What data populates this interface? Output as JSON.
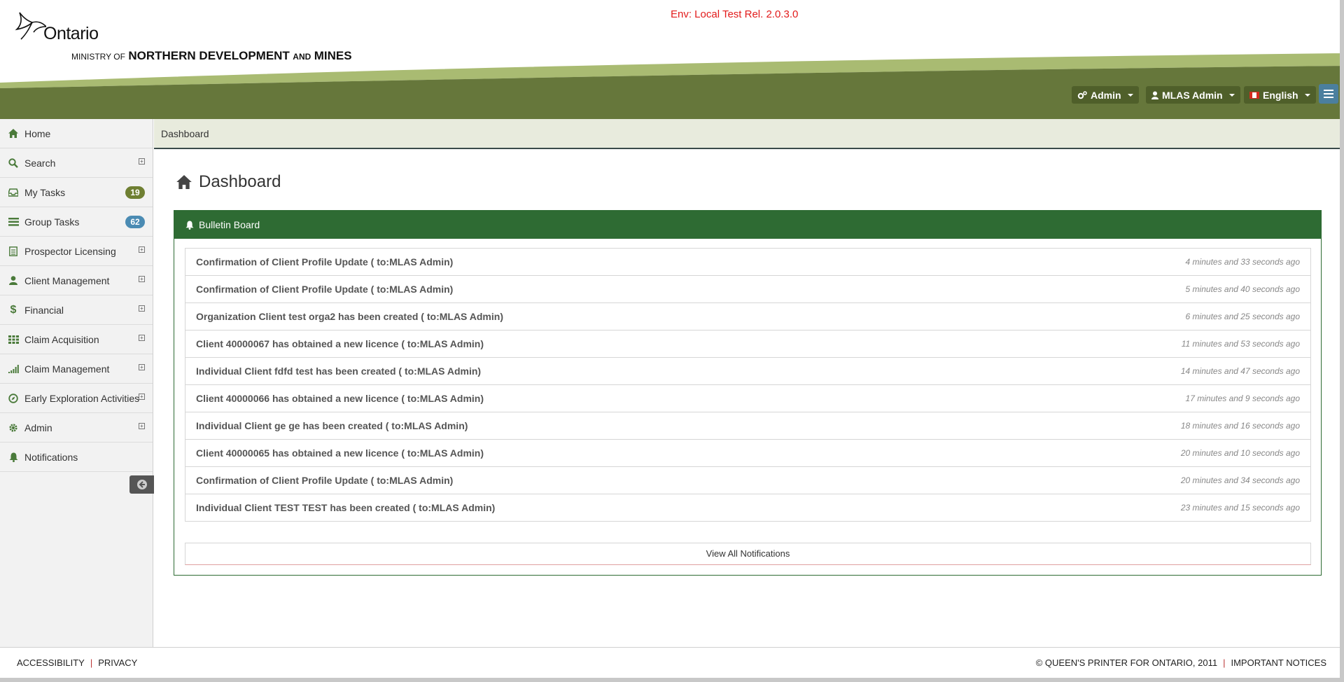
{
  "header": {
    "logo_text": "Ontario",
    "ministry_prefix": "MINISTRY OF",
    "ministry_part1": "NORTHERN DEVELOPMENT",
    "ministry_and": "AND",
    "ministry_part2": "MINES",
    "env_label": "Env: Local Test Rel. 2.0.3.0",
    "admin_menu": "Admin",
    "user_menu": "MLAS Admin",
    "language_menu": "English",
    "colors": {
      "band_dark": "#66773b",
      "band_light": "#a9bb72",
      "env_text": "#e21b1b"
    }
  },
  "sidebar": {
    "items": [
      {
        "label": "Home",
        "icon": "home-icon"
      },
      {
        "label": "Search",
        "icon": "search-icon",
        "expandable": true
      },
      {
        "label": "My Tasks",
        "icon": "inbox-icon",
        "badge": "19"
      },
      {
        "label": "Group Tasks",
        "icon": "list-icon",
        "badge": "62"
      },
      {
        "label": "Prospector Licensing",
        "icon": "document-icon",
        "expandable": true
      },
      {
        "label": "Client Management",
        "icon": "user-icon",
        "expandable": true
      },
      {
        "label": "Financial",
        "icon": "dollar-icon",
        "expandable": true
      },
      {
        "label": "Claim Acquisition",
        "icon": "grid-icon",
        "expandable": true
      },
      {
        "label": "Claim Management",
        "icon": "signal-icon",
        "expandable": true
      },
      {
        "label": "Early Exploration Activities",
        "icon": "compass-icon",
        "expandable": true
      },
      {
        "label": "Admin",
        "icon": "gear-icon",
        "expandable": true
      },
      {
        "label": "Notifications",
        "icon": "bell-icon"
      }
    ]
  },
  "main": {
    "breadcrumb": "Dashboard",
    "page_title": "Dashboard",
    "bulletin": {
      "title": "Bulletin Board",
      "messages": [
        {
          "text": "Confirmation of Client Profile Update ( to:MLAS Admin)",
          "time": "4 minutes and 33 seconds ago"
        },
        {
          "text": "Confirmation of Client Profile Update ( to:MLAS Admin)",
          "time": "5 minutes and 40 seconds ago"
        },
        {
          "text": "Organization Client test orga2 has been created ( to:MLAS Admin)",
          "time": "6 minutes and 25 seconds ago"
        },
        {
          "text": "Client 40000067 has obtained a new licence ( to:MLAS Admin)",
          "time": "11 minutes and 53 seconds ago"
        },
        {
          "text": "Individual Client fdfd test has been created ( to:MLAS Admin)",
          "time": "14 minutes and 47 seconds ago"
        },
        {
          "text": "Client 40000066 has obtained a new licence ( to:MLAS Admin)",
          "time": "17 minutes and 9 seconds ago"
        },
        {
          "text": "Individual Client ge ge has been created ( to:MLAS Admin)",
          "time": "18 minutes and 16 seconds ago"
        },
        {
          "text": "Client 40000065 has obtained a new licence ( to:MLAS Admin)",
          "time": "20 minutes and 10 seconds ago"
        },
        {
          "text": "Confirmation of Client Profile Update ( to:MLAS Admin)",
          "time": "20 minutes and 34 seconds ago"
        },
        {
          "text": "Individual Client TEST TEST has been created ( to:MLAS Admin)",
          "time": "23 minutes and 15 seconds ago"
        }
      ],
      "view_all": "View All Notifications"
    }
  },
  "footer": {
    "accessibility": "ACCESSIBILITY",
    "privacy": "PRIVACY",
    "separator": "|",
    "copyright": "© QUEEN'S PRINTER FOR ONTARIO, 2011",
    "notices": "IMPORTANT NOTICES"
  }
}
